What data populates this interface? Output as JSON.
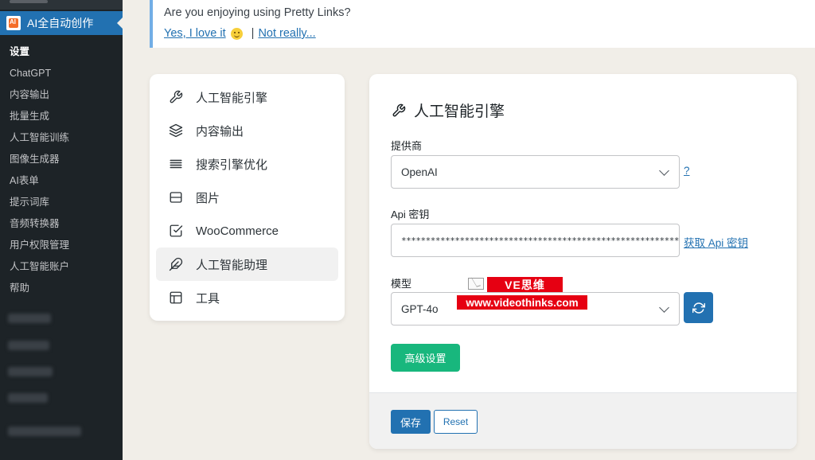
{
  "sidebar": {
    "active_menu": "AI全自动创作",
    "submenu": [
      "设置",
      "ChatGPT",
      "内容输出",
      "批量生成",
      "人工智能训练",
      "图像生成器",
      "AI表单",
      "提示词库",
      "音频转换器",
      "用户权限管理",
      "人工智能账户",
      "帮助"
    ]
  },
  "notice": {
    "question": "Are you enjoying using Pretty Links?",
    "yes": "Yes, I love it",
    "separator": "|",
    "no": "Not really..."
  },
  "nav": {
    "items": [
      {
        "label": "人工智能引擎",
        "icon": "wrench-icon"
      },
      {
        "label": "内容输出",
        "icon": "layers-icon"
      },
      {
        "label": "搜索引擎优化",
        "icon": "list-icon"
      },
      {
        "label": "图片",
        "icon": "image-box-icon"
      },
      {
        "label": "WooCommerce",
        "icon": "checkbox-icon"
      },
      {
        "label": "人工智能助理",
        "icon": "feather-icon"
      },
      {
        "label": "工具",
        "icon": "layout-icon"
      }
    ],
    "active_index": 5
  },
  "panel": {
    "title": "人工智能引擎",
    "provider_label": "提供商",
    "provider_value": "OpenAI",
    "provider_help": "?",
    "api_label": "Api 密钥",
    "api_value": "**********************************************************HI",
    "api_link": "获取 Api 密钥",
    "model_label": "模型",
    "model_value": "GPT-4o",
    "advanced_button": "高级设置",
    "save_button": "保存",
    "reset_button": "Reset"
  },
  "watermark": {
    "line1": "VE思维",
    "line2": "www.videothinks.com"
  },
  "colors": {
    "wp_blue": "#2271b1",
    "sidebar_bg": "#1d2327",
    "green": "#18b77d",
    "watermark_red": "#e60012"
  }
}
